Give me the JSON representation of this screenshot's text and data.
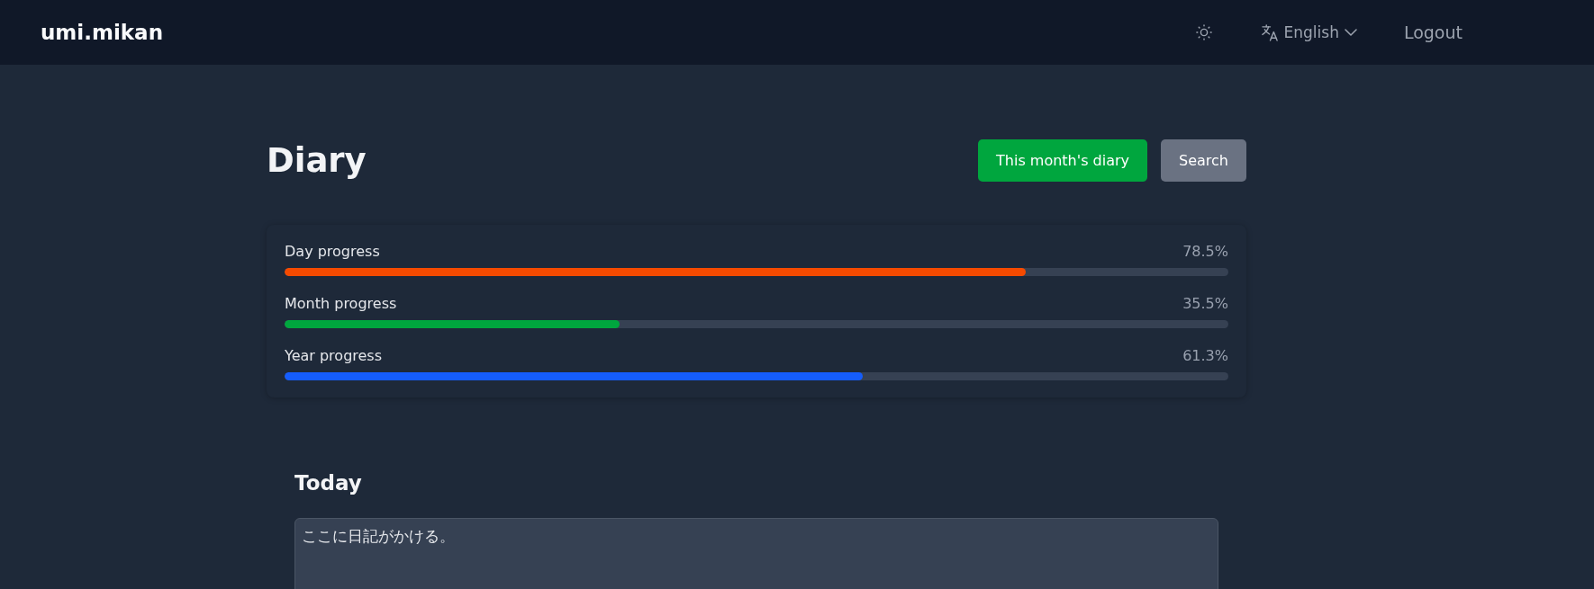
{
  "header": {
    "logo": "umi.mikan",
    "language": {
      "label": "English"
    },
    "logout": "Logout"
  },
  "page": {
    "title": "Diary",
    "buttons": [
      {
        "label": "This month's diary",
        "kind": "primary"
      },
      {
        "label": "Search",
        "kind": "secondary"
      }
    ]
  },
  "progress": [
    {
      "label": "Day progress",
      "reading": "78.5%",
      "level": 0.785,
      "color": "#f54a00"
    },
    {
      "label": "Month progress",
      "reading": "35.5%",
      "level": 0.355,
      "color": "#00a63e"
    },
    {
      "label": "Year progress",
      "reading": "61.3%",
      "level": 0.613,
      "color": "#155dfc"
    }
  ],
  "today": {
    "heading": "Today",
    "entry": {
      "value": "ここに日記がかける。"
    }
  }
}
